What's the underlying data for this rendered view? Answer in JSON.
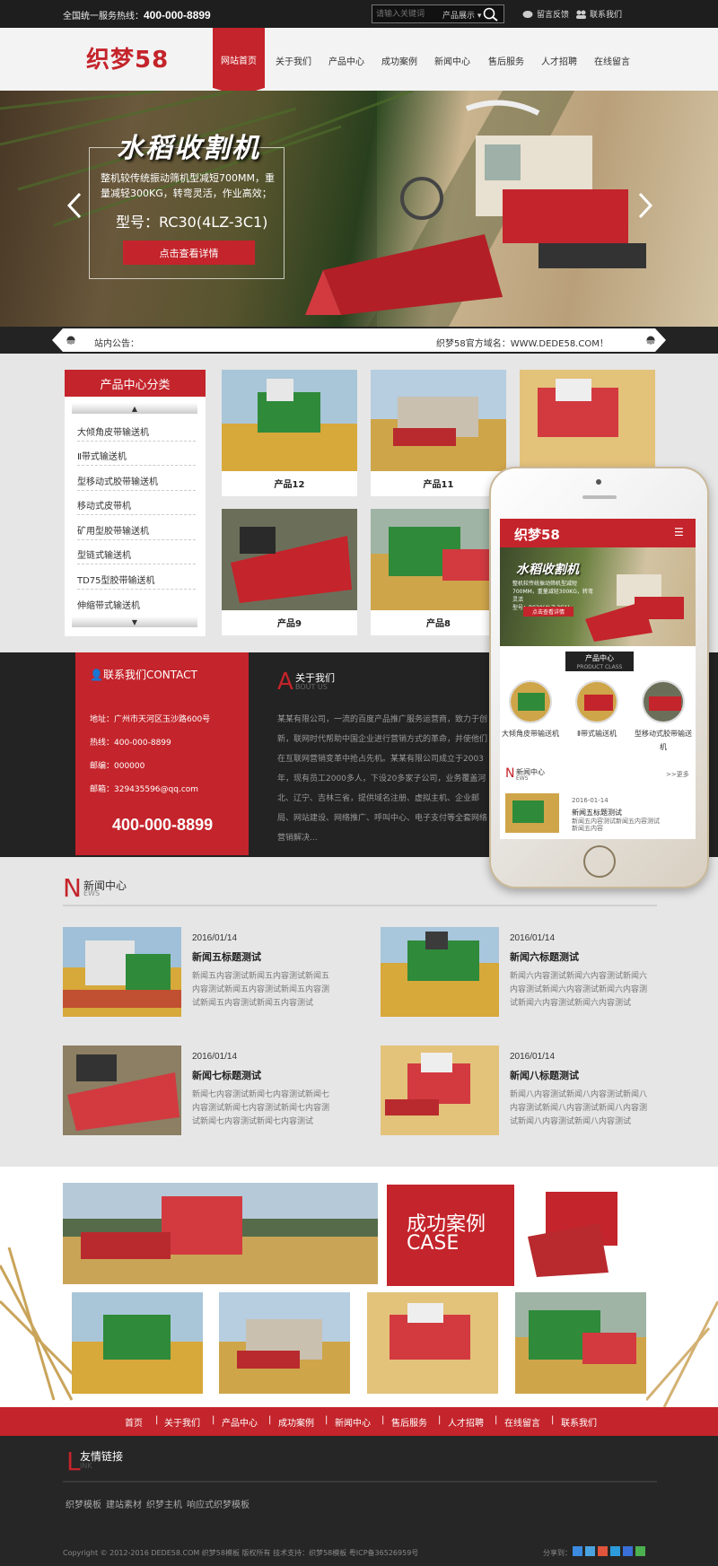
{
  "topbar": {
    "hotline_label": "全国统一服务热线：",
    "hotline_number": "400-000-8899",
    "search_placeholder": "请输入关键词",
    "search_category": "产品展示",
    "guestbook": "留言反馈",
    "contact": "联系我们"
  },
  "header": {
    "logo": "织梦58",
    "nav": [
      "网站首页",
      "关于我们",
      "产品中心",
      "成功案例",
      "新闻中心",
      "售后服务",
      "人才招聘",
      "在线留言"
    ]
  },
  "banner": {
    "title": "水稻收割机",
    "desc": "整机较传统振动筛机型减短700MM，重量减轻300KG，转弯灵活，作业高效；",
    "model": "型号：RC30(4LZ-3C1)",
    "button": "点击查看详情"
  },
  "notice": {
    "label": "站内公告：",
    "text": "织梦58官方域名：WWW.DEDE58.COM！"
  },
  "category": {
    "title": "产品中心分类",
    "items": [
      "大倾角皮带输送机",
      "Ⅱ带式输送机",
      "型移动式胶带输送机",
      "移动式皮带机",
      "矿用型胶带输送机",
      "型链式输送机",
      "TD75型胶带输送机",
      "伸缩带式输送机"
    ]
  },
  "products": [
    {
      "name": "产品12"
    },
    {
      "name": "产品11"
    },
    {
      "name": "产品9"
    },
    {
      "name": "产品8"
    }
  ],
  "contact": {
    "title": "联系我们CONTACT",
    "address": "地址：广州市天河区玉沙路600号",
    "hotline": "热线：400-000-8899",
    "postcode": "邮编：000000",
    "email": "邮箱：329435596@qq.com",
    "phone": "400-000-8899"
  },
  "about": {
    "letter": "A",
    "title": "关于我们",
    "sub": "BOUT US",
    "text": "某某有限公司，一流的百度产品推广服务运营商，致力于创新，联网时代帮助中国企业进行营销方式的革命，并使他们在互联网营销变革中抢占先机。某某有限公司成立于2003年，现有员工2000多人，下设20多家子公司，业务覆盖河北、辽宁、吉林三省，提供域名注册、虚拟主机、企业邮局、网站建设、网络推广、呼叫中心、电子支付等全套网络营销解决..."
  },
  "phone_mock": {
    "logo": "织梦58",
    "banner_title": "水稻收割机",
    "banner_desc": "整机较传统振动筛机型减短700MM，重量减轻300KG，转弯灵活",
    "banner_model": "型号：RC30(4LZ-3C1)",
    "banner_button": "点击查看详情",
    "prod_tab": "产品中心",
    "prod_tab_sub": "PRODUCT CLASS",
    "circles": [
      "大倾角皮带输送机",
      "Ⅱ带式输送机",
      "型移动式胶带输送机"
    ],
    "news_letter": "N",
    "news_title": "新闻中心",
    "news_sub": "EWS",
    "more": ">>更多",
    "news_date": "2016-01-14",
    "news_head": "新闻五标题测试",
    "news_text": "新闻五内容测试新闻五内容测试新闻五内容"
  },
  "news": {
    "letter": "N",
    "title": "新闻中心",
    "sub": "EWS",
    "items": [
      {
        "date": "2016/01/14",
        "title": "新闻五标题测试",
        "text": "新闻五内容测试新闻五内容测试新闻五内容测试新闻五内容测试新闻五内容测试新闻五内容测试新闻五内容测试"
      },
      {
        "date": "2016/01/14",
        "title": "新闻六标题测试",
        "text": "新闻六内容测试新闻六内容测试新闻六内容测试新闻六内容测试新闻六内容测试新闻六内容测试新闻六内容测试"
      },
      {
        "date": "2016/01/14",
        "title": "新闻七标题测试",
        "text": "新闻七内容测试新闻七内容测试新闻七内容测试新闻七内容测试新闻七内容测试新闻七内容测试新闻七内容测试"
      },
      {
        "date": "2016/01/14",
        "title": "新闻八标题测试",
        "text": "新闻八内容测试新闻八内容测试新闻八内容测试新闻八内容测试新闻八内容测试新闻八内容测试新闻八内容测试"
      }
    ]
  },
  "cases": {
    "title_cn": "成功案例",
    "title_en": "CASE"
  },
  "footnav": [
    "首页",
    "关于我们",
    "产品中心",
    "成功案例",
    "新闻中心",
    "售后服务",
    "人才招聘",
    "在线留言",
    "联系我们"
  ],
  "links": {
    "letter": "L",
    "title": "友情链接",
    "sub": "INK",
    "items": [
      "织梦模板",
      "建站素材",
      "织梦主机",
      "响应式织梦模板"
    ]
  },
  "footer": {
    "copyright": "Copyright © 2012-2016 DEDE58.COM 织梦58模板 版权所有    技术支持：织梦58模板    粤ICP备36526959号",
    "share": "分享到："
  },
  "colors": {
    "accent": "#c4242b",
    "dark": "#232323",
    "bg": "#e6e6e6"
  }
}
